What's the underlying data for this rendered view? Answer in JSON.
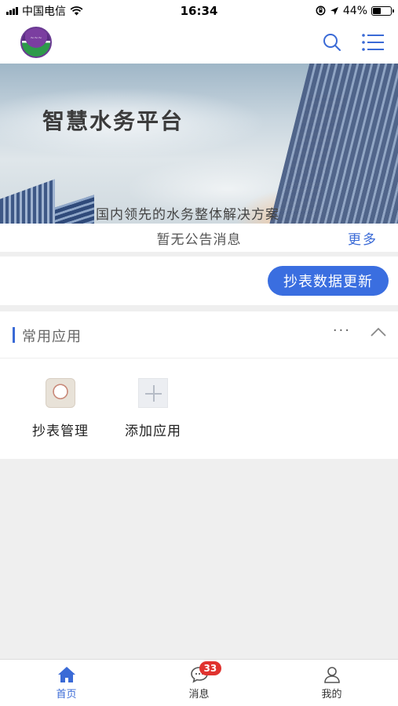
{
  "status_bar": {
    "carrier": "中国电信",
    "time": "16:34",
    "battery_percent": "44%",
    "battery_level": 0.44
  },
  "header": {
    "logo_icon": "water-company-logo",
    "search_icon": "search-icon",
    "menu_icon": "list-menu-icon",
    "accent": "#3a6ad6"
  },
  "banner": {
    "title": "智慧水务平台",
    "subtitle": "国内领先的水务整体解决方案"
  },
  "notice": {
    "text": "暂无公告消息",
    "more_label": "更多"
  },
  "update": {
    "button_label": "抄表数据更新",
    "color": "#3a6ee0"
  },
  "apps": {
    "title": "常用应用",
    "more_label": "···",
    "items": [
      {
        "label": "抄表管理",
        "icon": "meter-reading-icon"
      },
      {
        "label": "添加应用",
        "icon": "add-icon"
      }
    ]
  },
  "tabbar": {
    "tabs": [
      {
        "label": "首页",
        "icon": "home-icon",
        "active": true
      },
      {
        "label": "消息",
        "icon": "message-icon",
        "badge": "33"
      },
      {
        "label": "我的",
        "icon": "user-icon"
      }
    ]
  }
}
